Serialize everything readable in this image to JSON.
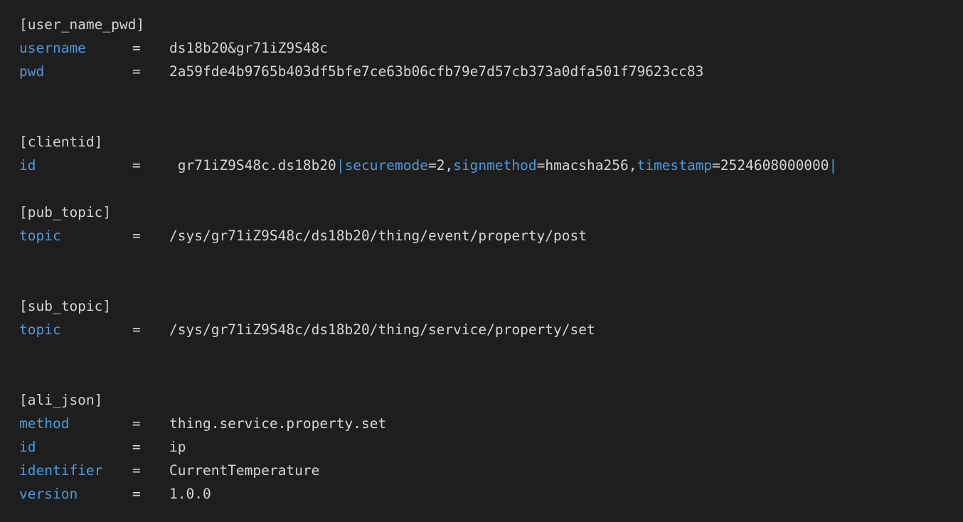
{
  "editor": {
    "background_color": "#1e1e1e",
    "key_color": "#4a9ae1",
    "text_color": "#d4d4d4",
    "equals_sign": "=",
    "sections": [
      {
        "header": "[user_name_pwd]",
        "entries": [
          {
            "key": "username",
            "value": "ds18b20&gr71iZ9S48c"
          },
          {
            "key": "pwd",
            "value": "2a59fde4b9765b403df5bfe7ce63b06cfb79e7d57cb373a0dfa501f79623cc83"
          }
        ]
      },
      {
        "header": "[clientid]",
        "entries": [
          {
            "key": "id",
            "value": " gr71iZ9S48c.ds18b20|securemode=2,signmethod=hmacsha256,timestamp=2524608000000|"
          }
        ]
      },
      {
        "header": "[pub_topic]",
        "entries": [
          {
            "key": "topic",
            "value": "/sys/gr71iZ9S48c/ds18b20/thing/event/property/post"
          }
        ]
      },
      {
        "header": "[sub_topic]",
        "entries": [
          {
            "key": "topic",
            "value": "/sys/gr71iZ9S48c/ds18b20/thing/service/property/set"
          }
        ]
      },
      {
        "header": "[ali_json]",
        "entries": [
          {
            "key": "method",
            "value": "thing.service.property.set"
          },
          {
            "key": "id",
            "value": "ip"
          },
          {
            "key": "identifier",
            "value": "CurrentTemperature"
          },
          {
            "key": "version",
            "value": "1.0.0"
          }
        ]
      }
    ],
    "clientid_tokens": [
      {
        "text": " gr71iZ9S48c.ds18b20",
        "style": "plain"
      },
      {
        "text": "|",
        "style": "blue"
      },
      {
        "text": "securemode",
        "style": "blue"
      },
      {
        "text": "=2,",
        "style": "plain"
      },
      {
        "text": "signmethod",
        "style": "blue"
      },
      {
        "text": "=hmacsha256,",
        "style": "plain"
      },
      {
        "text": "timestamp",
        "style": "blue"
      },
      {
        "text": "=2524608000000",
        "style": "plain"
      },
      {
        "text": "|",
        "style": "blue"
      }
    ]
  }
}
